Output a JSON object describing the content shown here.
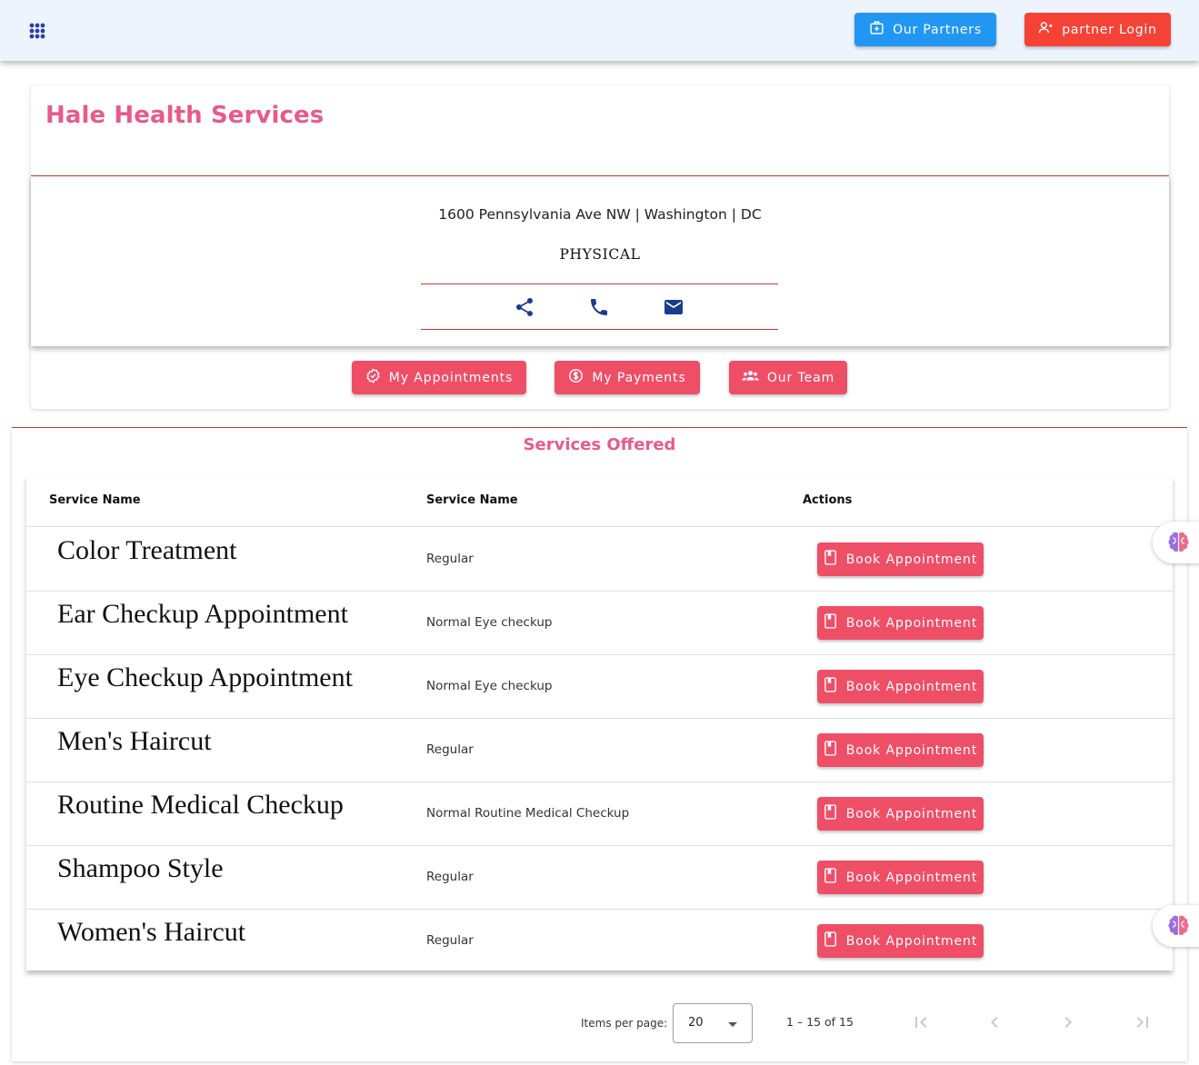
{
  "topbar": {
    "partners_label": "Our Partners",
    "login_label": "partner Login",
    "partners_color": "#2196f3",
    "login_color": "#f44336"
  },
  "business": {
    "name": "Hale Health Services",
    "address": "1600 Pennsylvania Ave NW | Washington | DC",
    "category": "PHYSICAL"
  },
  "actions": [
    {
      "label": "My Appointments",
      "icon": "check-badge-icon"
    },
    {
      "label": "My Payments",
      "icon": "dollar-circle-icon"
    },
    {
      "label": "Our Team",
      "icon": "group-icon"
    }
  ],
  "services": {
    "title": "Services Offered",
    "columns": [
      "Service Name",
      "Service Name",
      "Actions"
    ],
    "rows": [
      {
        "name": "Color Treatment",
        "type": "Regular",
        "action": "Book Appointment"
      },
      {
        "name": "Ear Checkup Appointment",
        "type": "Normal Eye checkup",
        "action": "Book Appointment"
      },
      {
        "name": "Eye Checkup Appointment",
        "type": "Normal Eye checkup",
        "action": "Book Appointment"
      },
      {
        "name": "Men's Haircut",
        "type": "Regular",
        "action": "Book Appointment"
      },
      {
        "name": "Routine Medical Checkup",
        "type": "Normal Routine Medical Checkup",
        "action": "Book Appointment"
      },
      {
        "name": "Shampoo Style",
        "type": "Regular",
        "action": "Book Appointment"
      },
      {
        "name": "Women's Haircut",
        "type": "Regular",
        "action": "Book Appointment"
      }
    ]
  },
  "paginator": {
    "items_per_page_label": "Items per page:",
    "items_per_page": "20",
    "range": "1 – 15 of 15"
  },
  "colors": {
    "accent": "#e85a8c",
    "button": "#ef4e67",
    "rule": "#c23b2b",
    "icon": "#1a3c8c"
  }
}
